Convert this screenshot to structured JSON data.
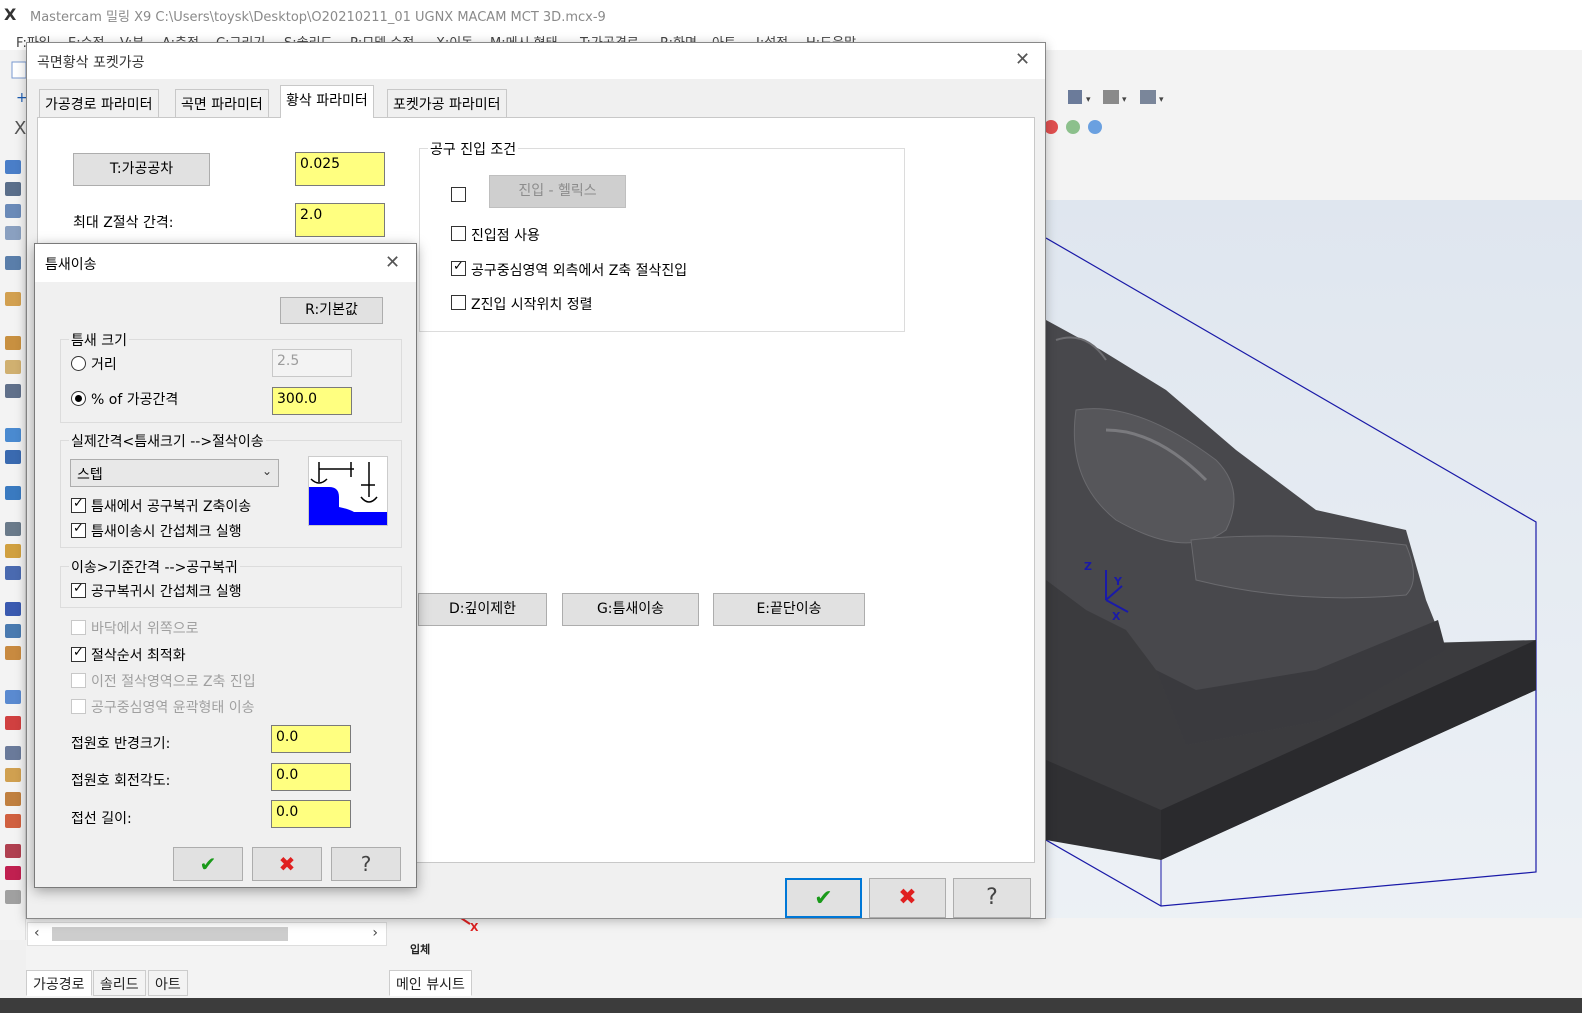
{
  "app": {
    "title": "Mastercam 밀링 X9  C:\\Users\\toysk\\Desktop\\O20210211_01 UGNX MACAM MCT 3D.mcx-9",
    "logo": "X",
    "menu": [
      "F:파일",
      "E:수정",
      "V:뷰",
      "A:측정",
      "C:그리기",
      "S:솔리드",
      "P:모델 수정",
      "X:이동",
      "M:메시 형태",
      "T:가공경로",
      "R:화면",
      "아트",
      "I:설정",
      "H:도움말"
    ]
  },
  "pocket_dialog": {
    "title": "곡면황삭 포켓가공",
    "tabs": [
      "가공경로 파라미터",
      "곡면 파라미터",
      "황삭 파라미터",
      "포켓가공 파라미터"
    ],
    "active_tab": 2,
    "tolerance_button": "T:가공공차",
    "tolerance_value": "0.025",
    "max_z_label": "최대 Z절삭 간격:",
    "max_z_value": "2.0",
    "entry_group_title": "공구 진입 조건",
    "helix_button": "진입 - 헬릭스",
    "entry_point_label": "진입점 사용",
    "outside_z_entry_label": "공구중심영역 외측에서 Z축 절삭진입",
    "z_start_sort_label": "Z진입 시작위치 정렬",
    "depth_limit_button": "D:깊이제한",
    "gap_move_button": "G:틈새이송",
    "edge_move_button": "E:끝단이송"
  },
  "gap_dialog": {
    "title": "틈새이송",
    "default_button": "R:기본값",
    "gap_size_title": "틈새 크기",
    "distance_label": "거리",
    "distance_value": "2.5",
    "percent_label": "% of 가공간격",
    "percent_value": "300.0",
    "actual_gap_title": "실제간격<틈새크기  -->절삭이송",
    "move_type": "스텝",
    "retract_z_label": "틈새에서 공구복귀 Z축이송",
    "gap_check_label": "틈새이송시 간섭체크 실행",
    "move_over_title": "이송>기준간격  -->공구복귀",
    "retract_check_label": "공구복귀시 간섭체크 실행",
    "bottom_up_label": "바닥에서 위쪽으로",
    "optimize_label": "절삭순서 최적화",
    "prev_region_label": "이전 절삭영역으로 Z축 진입",
    "contour_move_label": "공구중심영역 윤곽형태 이송",
    "arc_radius_label": "접원호 반경크기:",
    "arc_radius_value": "0.0",
    "arc_angle_label": "접원호 회전각도:",
    "arc_angle_value": "0.0",
    "tangent_length_label": "접선 길이:",
    "tangent_length_value": "0.0"
  },
  "bottom": {
    "tabs": [
      "가공경로",
      "솔리드",
      "아트"
    ],
    "view_tab": "메인 뷰시트",
    "view_label": "입체"
  },
  "viewport": {
    "axis_z": "Z",
    "axis_y": "Y",
    "axis_x": "X",
    "part_color": "#3b3b3e",
    "stock_outline_color": "#1a1aa8"
  },
  "icons": {
    "ok": "check-icon",
    "cancel": "x-icon",
    "help": "question-icon"
  }
}
